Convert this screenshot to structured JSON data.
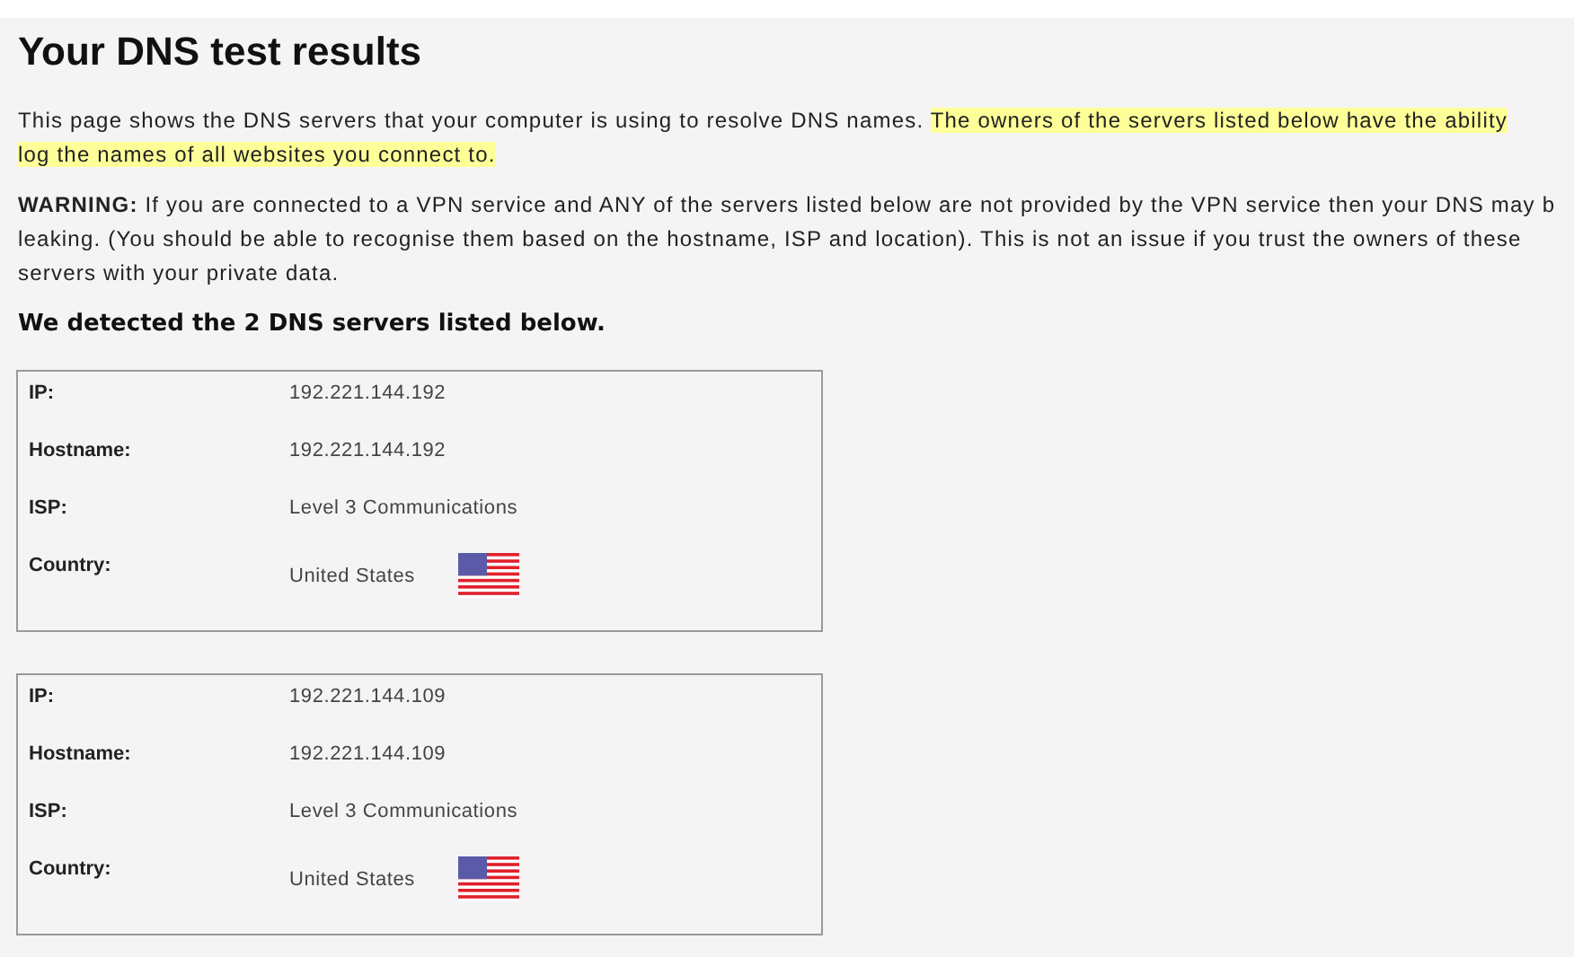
{
  "title": "Your DNS test results",
  "intro_lines": [
    [
      {
        "text": "This page shows the DNS servers that your computer is using to resolve DNS names. ",
        "highlighted": false
      },
      {
        "text": "The owners of the servers listed below have the ability",
        "highlighted": true
      }
    ],
    [
      {
        "text": "log the names of all websites you connect to.",
        "highlighted": true
      }
    ]
  ],
  "warning_lines": [
    "**WARNING:** If you are connected to a VPN service and ANY of the servers listed below are not provided by the VPN service then your DNS may b",
    "leaking. (You should be able to recognise them based on the hostname, ISP and location). This is not an issue if you trust the owners of these",
    "servers with your private data."
  ],
  "summary": "We detected the 2 DNS servers listed below.",
  "servers": [
    {
      "fields": [
        {
          "label": "IP:",
          "value": "192.221.144.192"
        },
        {
          "label": "Hostname:",
          "value": "192.221.144.192"
        },
        {
          "label": "ISP:",
          "value": "Level 3 Communications"
        },
        {
          "label": "Country:",
          "value": "United States",
          "kind": "country"
        }
      ]
    },
    {
      "fields": [
        {
          "label": "IP:",
          "value": "192.221.144.109"
        },
        {
          "label": "Hostname:",
          "value": "192.221.144.109"
        },
        {
          "label": "ISP:",
          "value": "Level 3 Communications"
        },
        {
          "label": "Country:",
          "value": "United States",
          "kind": "country"
        }
      ]
    }
  ]
}
